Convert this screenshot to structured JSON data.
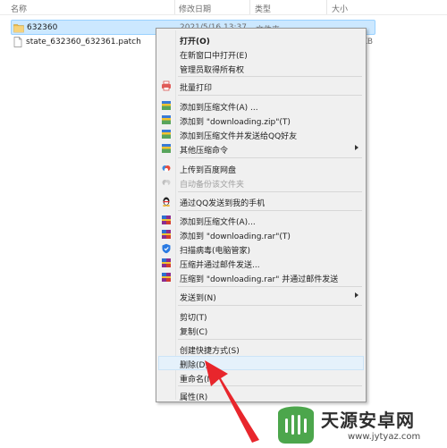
{
  "columns": {
    "name": "名称",
    "date": "修改日期",
    "type": "类型",
    "size": "大小"
  },
  "files": [
    {
      "name": "632360",
      "date": "2021/5/16 13:37",
      "type": "文件夹",
      "size": "",
      "icon": "folder-icon"
    },
    {
      "name": "state_632360_632361.patch",
      "date": "",
      "type": "",
      "size": "KB",
      "icon": "file-icon"
    }
  ],
  "menu": {
    "items": [
      {
        "label": "打开(O)",
        "bold": true
      },
      {
        "label": "在新窗口中打开(E)"
      },
      {
        "label": "管理员取得所有权"
      },
      {
        "label": "批量打印",
        "icon": "printer-icon"
      },
      {
        "label": "添加到压缩文件(A) ...",
        "icon": "archive-icon"
      },
      {
        "label": "添加到 \"downloading.zip\"(T)",
        "icon": "archive-icon"
      },
      {
        "label": "添加到压缩文件并发送给QQ好友",
        "icon": "archive-icon"
      },
      {
        "label": "其他压缩命令",
        "icon": "archive-icon"
      },
      {
        "label": "上传到百度网盘",
        "icon": "cloud-icon"
      },
      {
        "label": "自动备份该文件夹",
        "icon": "cloud-icon"
      },
      {
        "label": "通过QQ发送到我的手机",
        "icon": "qq-penguin-icon"
      },
      {
        "label": "添加到压缩文件(A)...",
        "icon": "winrar-icon"
      },
      {
        "label": "添加到 \"downloading.rar\"(T)",
        "icon": "winrar-icon"
      },
      {
        "label": "扫描病毒(电脑管家)",
        "icon": "shield-icon"
      },
      {
        "label": "压缩并通过邮件发送...",
        "icon": "winrar-icon"
      },
      {
        "label": "压缩到 \"downloading.rar\" 并通过邮件发送",
        "icon": "winrar-icon"
      },
      {
        "label": "发送到(N)"
      },
      {
        "label": "剪切(T)"
      },
      {
        "label": "复制(C)"
      },
      {
        "label": "创建快捷方式(S)"
      },
      {
        "label": "删除(D)"
      },
      {
        "label": "重命名(M)"
      },
      {
        "label": "属性(R)"
      }
    ]
  },
  "watermark": {
    "name": "天源安卓网",
    "url": "www.jytyaz.com"
  },
  "colors": {
    "selection": "#cce8ff",
    "highlight": "#e5f1fb",
    "arrow": "#e8262c",
    "menu_bg": "#f0f0f0"
  }
}
